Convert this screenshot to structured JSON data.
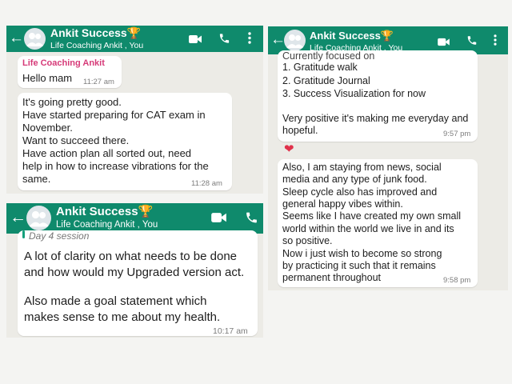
{
  "chat": {
    "contact_name": "Ankit Success🏆",
    "contact_subtitle": "Life Coaching Ankit , You"
  },
  "panel1": {
    "msg1": {
      "sender": "Life Coaching Ankit",
      "text": "Hello mam",
      "time": "11:27 am"
    },
    "msg2": {
      "lines": [
        "It's going pretty good.",
        "Have started preparing for CAT exam in",
        "November.",
        "Want to succeed there.",
        "Have action plan all sorted out, need",
        "help in how to increase vibrations for the",
        "same."
      ],
      "time": "11:28 am"
    }
  },
  "panel2": {
    "quoted_preview": "Day 4 session",
    "lines": [
      "A lot of clarity on what needs to be done",
      "and how would my Upgraded version act.",
      "",
      "Also made a goal statement which",
      "makes sense to me about my health."
    ],
    "time": "10:17 am"
  },
  "panel3": {
    "msg1": {
      "lines": [
        "Currently focused on",
        "1. Gratitude walk",
        "2. Gratitude Journal",
        "3. Success Visualization for now",
        "",
        "Very positive it's making me everyday and",
        "hopeful."
      ],
      "time": "9:57 pm"
    },
    "reaction": "❤",
    "msg2": {
      "lines": [
        "Also, I am staying from news, social",
        "media and any type of junk food.",
        "Sleep cycle also has improved and",
        "general happy vibes within.",
        "Seems like I have created my own small",
        "world within the world we live in and its",
        "so positive.",
        "Now i just wish to become so strong",
        "by practicing it such that it remains",
        "permanent throughout"
      ],
      "time": "9:58 pm"
    }
  },
  "icons": {
    "back": "back-arrow-icon",
    "avatar": "group-avatar-icon",
    "video": "video-call-icon",
    "phone": "voice-call-icon",
    "menu": "more-options-icon"
  },
  "colors": {
    "header": "#0f8a6c",
    "chat_background": "#ecebe6",
    "sender_name": "#d63a78",
    "heart": "#e0314b"
  }
}
